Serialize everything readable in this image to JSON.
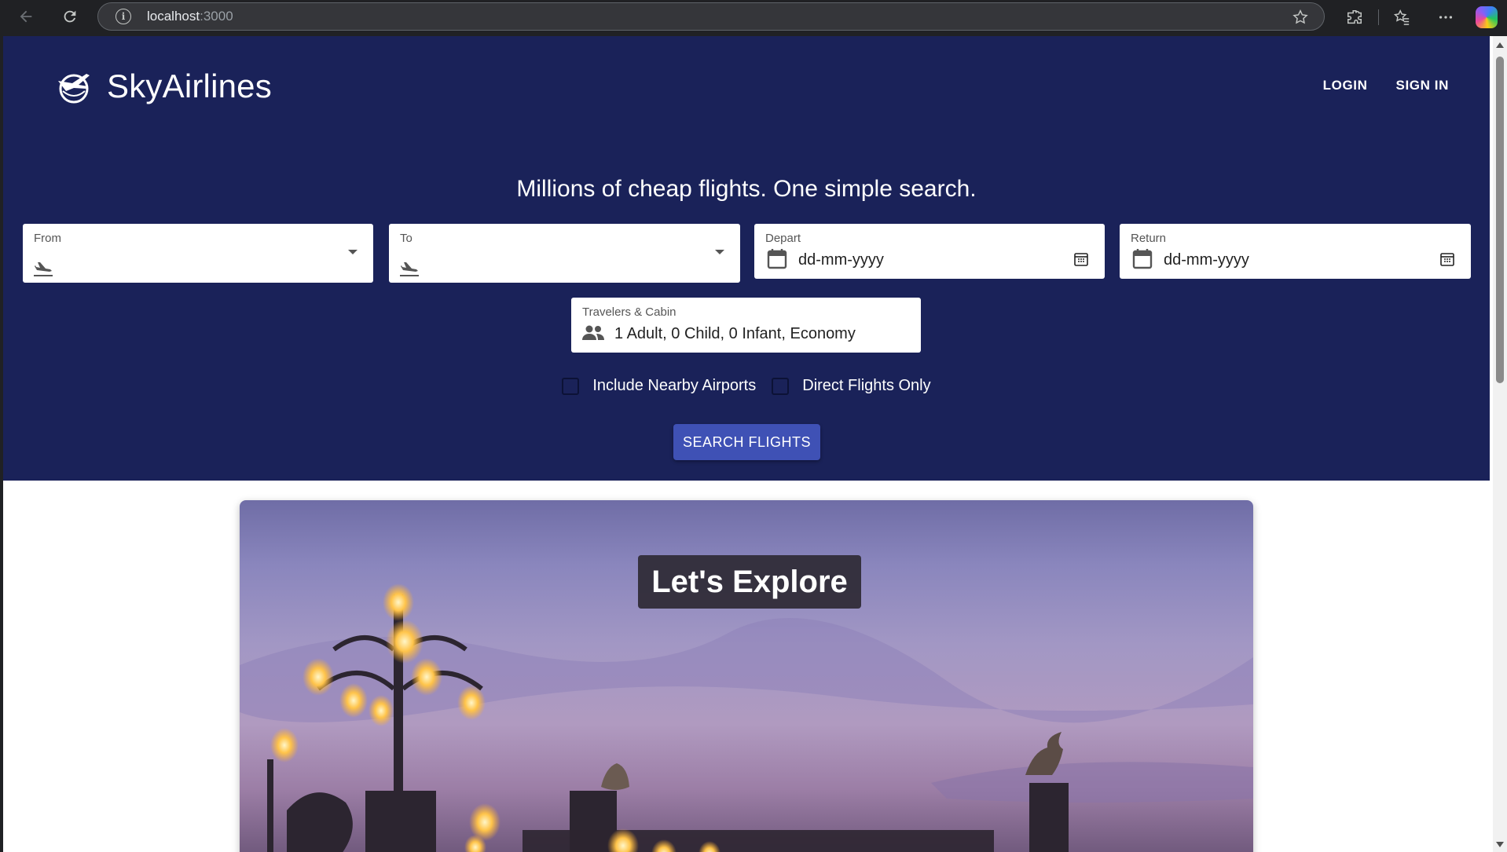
{
  "browser": {
    "url_host": "localhost",
    "url_port": ":3000"
  },
  "header": {
    "brand": "SkyAirlines",
    "nav": {
      "login": "LOGIN",
      "signin": "SIGN IN"
    }
  },
  "search": {
    "tagline": "Millions of cheap flights. One simple search.",
    "from": {
      "label": "From",
      "value": "",
      "icon": "plane-takeoff-icon"
    },
    "to": {
      "label": "To",
      "value": "",
      "icon": "plane-takeoff-icon"
    },
    "depart": {
      "label": "Depart",
      "placeholder": "dd-mm-yyyy"
    },
    "return": {
      "label": "Return",
      "placeholder": "dd-mm-yyyy"
    },
    "travelers": {
      "label": "Travelers & Cabin",
      "value": "1 Adult, 0 Child, 0 Infant, Economy"
    },
    "options": {
      "nearby": {
        "label": "Include Nearby Airports",
        "checked": false
      },
      "direct": {
        "label": "Direct Flights Only",
        "checked": false
      }
    },
    "button": "SEARCH FLIGHTS"
  },
  "explore": {
    "title": "Let's Explore"
  },
  "colors": {
    "hero_bg": "#1a2259",
    "button_bg": "#3f51b5"
  }
}
